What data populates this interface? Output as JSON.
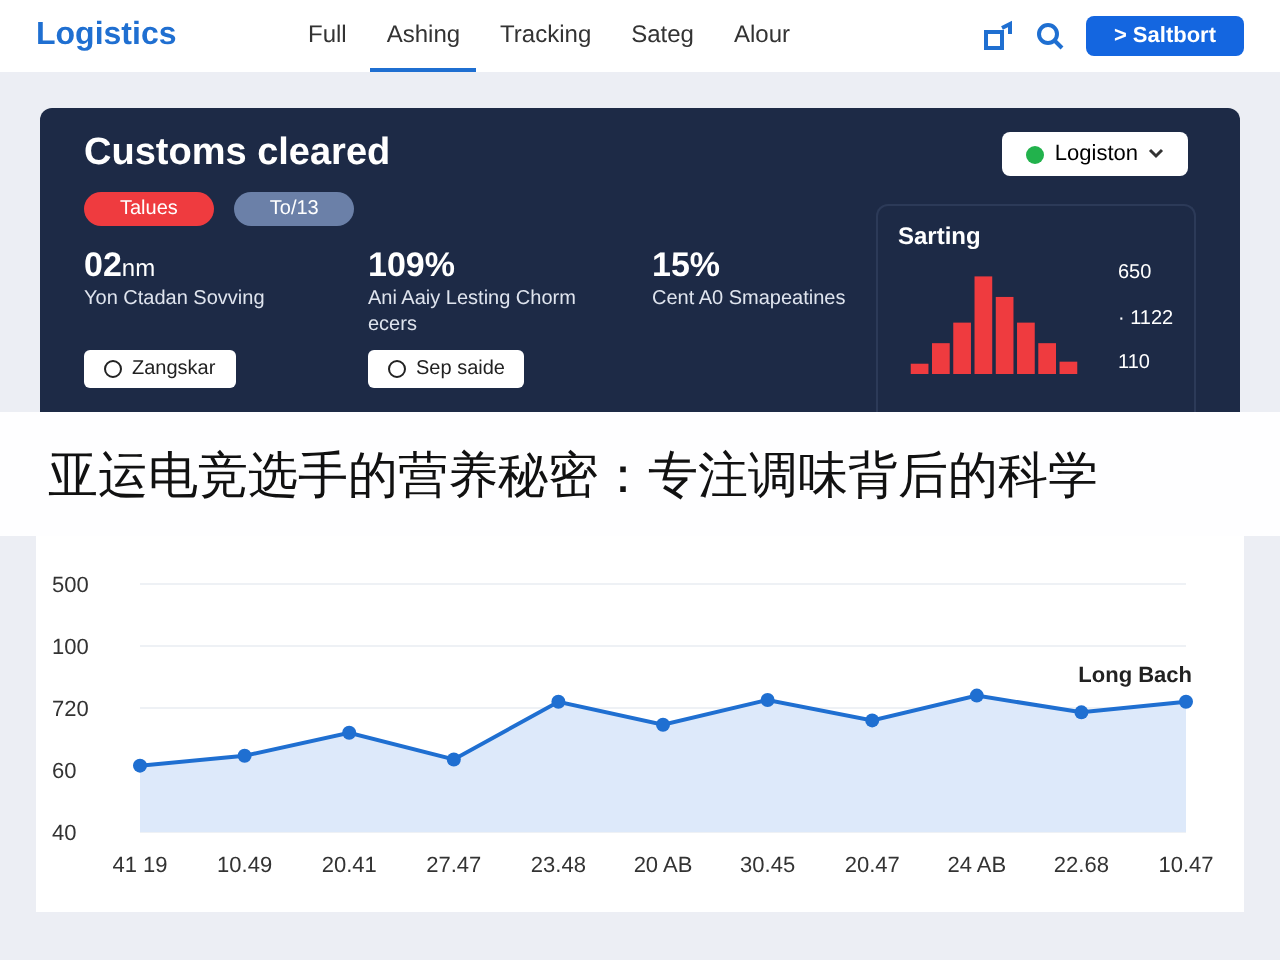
{
  "nav": {
    "brand": "Logistics",
    "tabs": [
      {
        "label": "Full",
        "selected": false
      },
      {
        "label": "Ashing",
        "selected": true
      },
      {
        "label": "Tracking",
        "selected": false
      },
      {
        "label": "Sateg",
        "selected": false
      },
      {
        "label": "Alour",
        "selected": false
      }
    ],
    "cta": "> Saltbort"
  },
  "hero": {
    "title": "Customs cleared",
    "tags": [
      {
        "label": "Talues",
        "color": "#ef3b3f"
      },
      {
        "label": "To/13",
        "color": "#6b80a8"
      }
    ],
    "stats": [
      {
        "value": "02",
        "unit": "nm",
        "label": "Yon Ctadan Sovving",
        "action": "Zangskar"
      },
      {
        "value": "109%",
        "label": "Ani Aaiy Lesting Chorm ecers",
        "action": "Sep saide"
      },
      {
        "value": "15%",
        "label": "Cent A0 Smapeatines"
      }
    ],
    "dropdown": "Logiston",
    "panel": {
      "title": "Sarting",
      "readings": [
        "650",
        "· 1122",
        "110"
      ]
    }
  },
  "headline": "亚运电竞选手的营养秘密：专注调味背后的科学",
  "chart": {
    "y_labels": [
      "500",
      "100",
      "720",
      "60",
      "40"
    ],
    "x_labels": [
      "41 19",
      "10.49",
      "20.41",
      "27.47",
      "23.48",
      "20 AB",
      "30.45",
      "20.47",
      "24 AB",
      "22.68",
      "10.47"
    ],
    "series_label": "Long Bach"
  }
}
